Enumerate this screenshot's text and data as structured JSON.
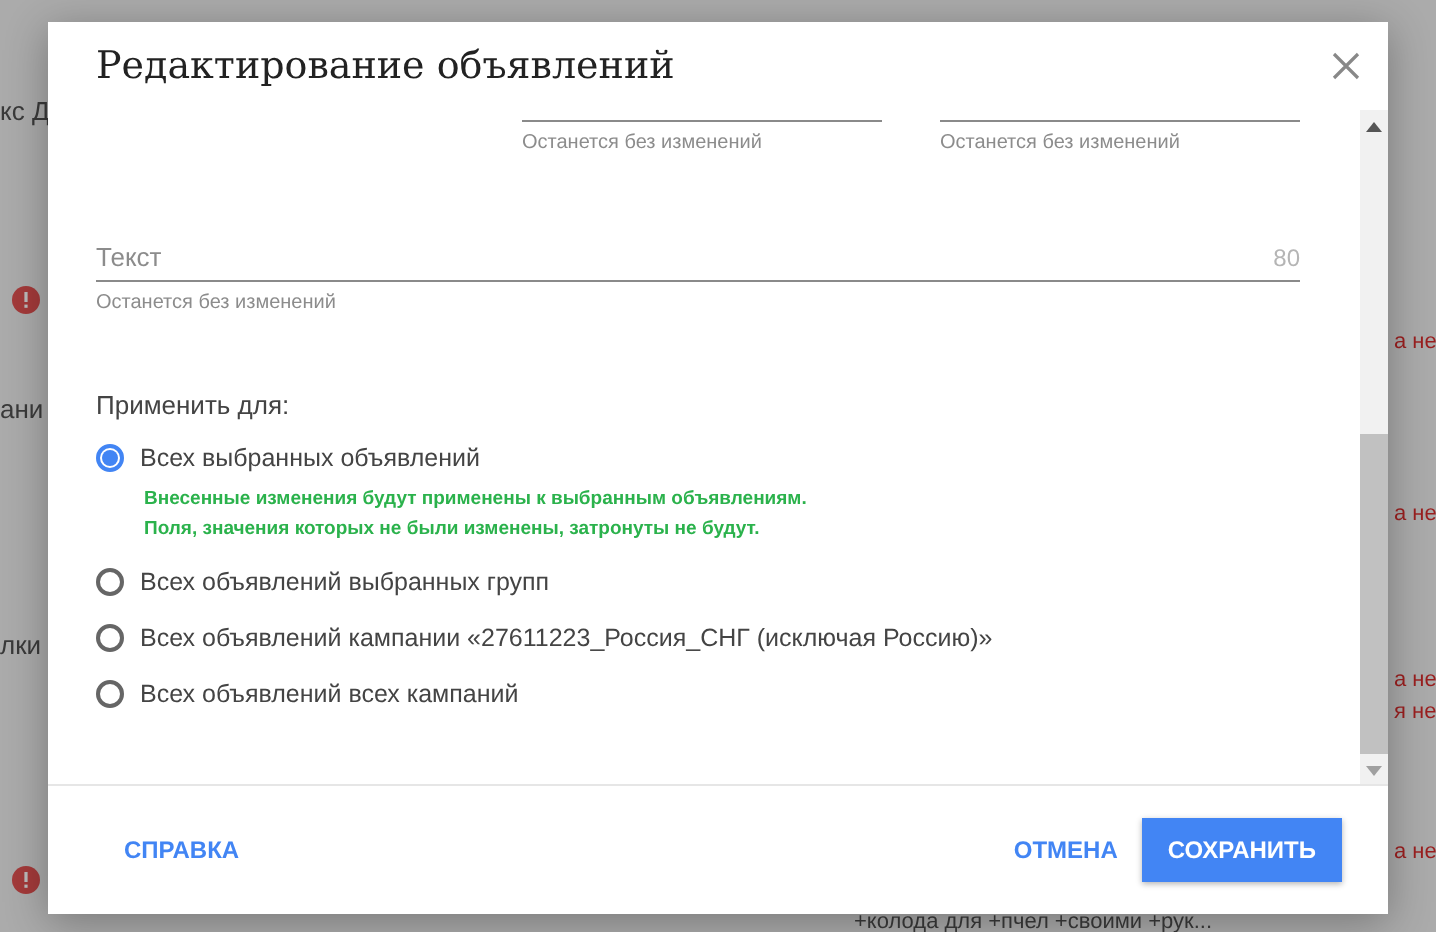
{
  "background": {
    "left_texts": [
      "кс Д",
      "ани",
      "лки"
    ],
    "right_texts": [
      "а не",
      "а не",
      "а не",
      "я не",
      "а не"
    ],
    "bottom_text": "+колода для +пчел +своими +рук..."
  },
  "dialog": {
    "title": "Редактирование объявлений",
    "fields": [
      {
        "helper": "Останется без изменений"
      },
      {
        "helper": "Останется без изменений"
      }
    ],
    "text_field": {
      "placeholder": "Текст",
      "counter": "80",
      "helper": "Останется без изменений"
    },
    "apply_label": "Применить для:",
    "options": [
      {
        "label": "Всех выбранных объявлений",
        "selected": true,
        "note": [
          "Внесенные изменения будут применены к выбранным объявлениям.",
          "Поля, значения которых не были изменены, затронуты не будут."
        ]
      },
      {
        "label": "Всех объявлений выбранных групп",
        "selected": false
      },
      {
        "label": "Всех объявлений кампании «27611223_Россия_СНГ (исключая Россию)»",
        "selected": false
      },
      {
        "label": "Всех объявлений всех кампаний",
        "selected": false
      }
    ],
    "buttons": [
      {
        "kind": "link",
        "label": "СПРАВКА"
      },
      {
        "kind": "flat",
        "label": "ОТМЕНА"
      },
      {
        "kind": "raised",
        "label": "СОХРАНИТЬ"
      }
    ]
  }
}
